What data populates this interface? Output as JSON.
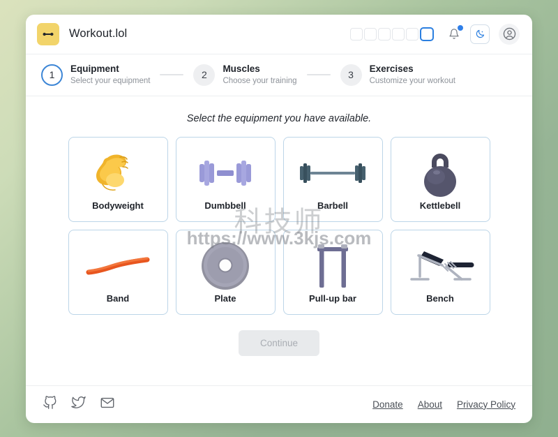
{
  "app": {
    "title": "Workout.lol",
    "logo_icon": "barbell-icon",
    "logo_color": "#f2d46a"
  },
  "header": {
    "swatch_count": 6,
    "selected_swatch_index": 5,
    "selected_swatch_color": "#2b7fe0",
    "notification_icon": "bell-icon",
    "notification_dot": true,
    "notification_dot_color": "#2f7fe8",
    "theme_toggle_icon": "moon-icon",
    "theme_toggle_color": "#2b7fe0",
    "account_icon": "user-avatar-icon"
  },
  "stepper": {
    "steps": [
      {
        "number": "1",
        "title": "Equipment",
        "subtitle": "Select your equipment",
        "state": "active"
      },
      {
        "number": "2",
        "title": "Muscles",
        "subtitle": "Choose your training",
        "state": "inactive"
      },
      {
        "number": "3",
        "title": "Exercises",
        "subtitle": "Customize your workout",
        "state": "inactive"
      }
    ],
    "active_color": "#3d86d6"
  },
  "main": {
    "prompt": "Select the equipment you have available.",
    "equipment": [
      {
        "label": "Bodyweight",
        "icon": "flexed-biceps-icon",
        "selected": false
      },
      {
        "label": "Dumbbell",
        "icon": "dumbbell-icon",
        "selected": false
      },
      {
        "label": "Barbell",
        "icon": "barbell-icon",
        "selected": false
      },
      {
        "label": "Kettlebell",
        "icon": "kettlebell-icon",
        "selected": false
      },
      {
        "label": "Band",
        "icon": "resistance-band-icon",
        "selected": false
      },
      {
        "label": "Plate",
        "icon": "weight-plate-icon",
        "selected": false
      },
      {
        "label": "Pull-up bar",
        "icon": "pullup-bar-icon",
        "selected": false
      },
      {
        "label": "Bench",
        "icon": "weight-bench-icon",
        "selected": false
      }
    ],
    "continue_label": "Continue",
    "continue_disabled": true,
    "card_border_color": "#bcd5e8"
  },
  "footer": {
    "social": [
      {
        "icon": "github-icon"
      },
      {
        "icon": "twitter-icon"
      },
      {
        "icon": "email-icon"
      }
    ],
    "links": [
      {
        "label": "Donate"
      },
      {
        "label": "About"
      },
      {
        "label": "Privacy Policy"
      }
    ]
  },
  "watermark": {
    "chinese": "科技师",
    "url": "https://www.3kjs.com"
  }
}
